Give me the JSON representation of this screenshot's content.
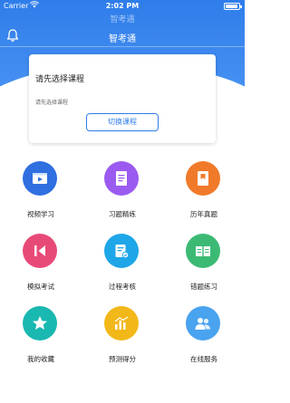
{
  "status_bar": {
    "carrier": "Carrier",
    "time": "2:02 PM"
  },
  "ghost_title": "智考通",
  "nav": {
    "title": "智考通"
  },
  "course_card": {
    "title": "请先选择课程",
    "subtitle": "请先选择课程",
    "button": "切换课程"
  },
  "colors": {
    "brand_blue": "#2f7dea",
    "video": "#2f6fe0",
    "exercise": "#9b5bf0",
    "past_exam": "#f07a2a",
    "mock": "#e84a78",
    "process": "#1ea6e8",
    "wrong": "#3cba74",
    "favorites": "#19b8b0",
    "predict": "#f2b81a",
    "service": "#4aa3ef"
  },
  "menu": [
    {
      "label": "视频学习",
      "icon": "video-icon"
    },
    {
      "label": "习题精练",
      "icon": "document-icon"
    },
    {
      "label": "历年真题",
      "icon": "bookmark-book-icon"
    },
    {
      "label": "模拟考试",
      "icon": "play-exam-icon"
    },
    {
      "label": "过程考核",
      "icon": "assessment-icon"
    },
    {
      "label": "错题练习",
      "icon": "open-book-icon"
    },
    {
      "label": "我的收藏",
      "icon": "star-icon"
    },
    {
      "label": "预测得分",
      "icon": "chart-icon"
    },
    {
      "label": "在线服务",
      "icon": "users-icon"
    }
  ]
}
